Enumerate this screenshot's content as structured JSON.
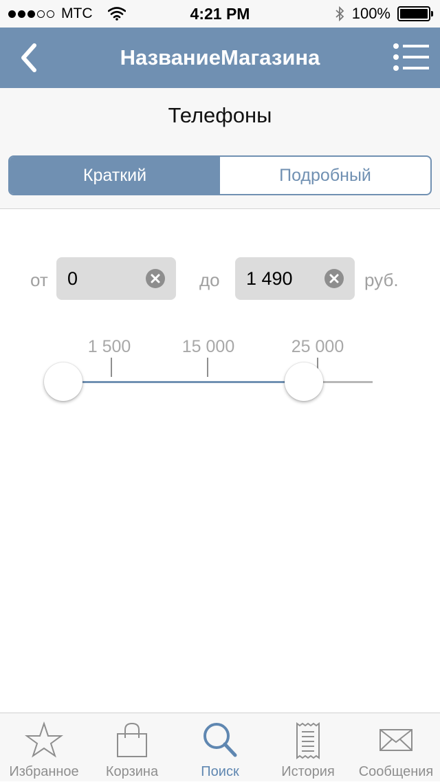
{
  "status_bar": {
    "carrier": "МТС",
    "time": "4:21 PM",
    "battery": "100%"
  },
  "navbar": {
    "title": "НазваниеМагазина",
    "back_icon": "chevron-left-icon",
    "menu_icon": "list-menu-icon"
  },
  "category": {
    "title": "Телефоны"
  },
  "segments": {
    "items": [
      "Краткий",
      "Подробный"
    ],
    "selected": "Краткий"
  },
  "price": {
    "from_label": "от",
    "from_value": "0",
    "to_label": "до",
    "to_value": "1 490",
    "currency": "руб."
  },
  "slider": {
    "ticks": [
      "1 500",
      "15 000",
      "25 000"
    ],
    "min_value": "0",
    "max_value": "1 490"
  },
  "tabbar": {
    "items": [
      "Избранное",
      "Корзина",
      "Поиск",
      "История",
      "Сообщения"
    ],
    "selected": "Поиск"
  },
  "colors": {
    "accent": "#7090b2",
    "tab_active": "#5f87b1",
    "background": "#f7f7f7"
  }
}
